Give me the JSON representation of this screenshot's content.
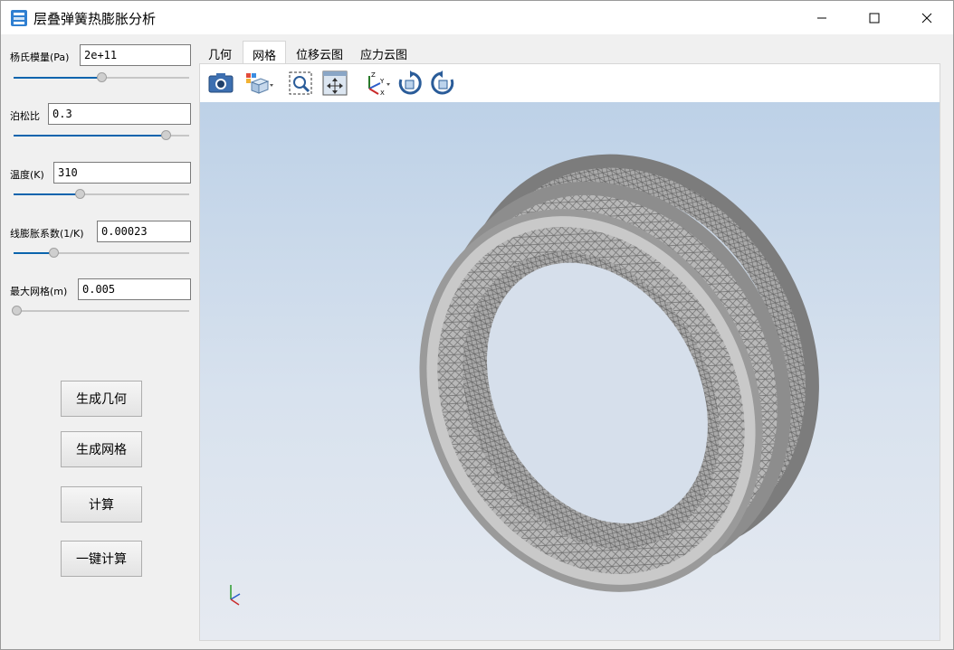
{
  "window": {
    "title": "层叠弹簧热膨胀分析",
    "icon": "app-icon",
    "controls": {
      "minimize": "minimize-icon",
      "maximize": "maximize-icon",
      "close": "close-icon"
    }
  },
  "params": [
    {
      "label": "杨氏模量(Pa)",
      "value": "2e+11",
      "slider_fraction": 0.5
    },
    {
      "label": "泊松比",
      "value": "0.3",
      "slider_fraction": 0.88
    },
    {
      "label": "温度(K)",
      "value": "310",
      "slider_fraction": 0.37
    },
    {
      "label": "线膨胀系数(1/K)",
      "value": "0.00023",
      "slider_fraction": 0.22
    },
    {
      "label": "最大网格(m)",
      "value": "0.005",
      "slider_fraction": 0.0
    }
  ],
  "buttons": {
    "gen_geometry": "生成几何",
    "gen_mesh": "生成网格",
    "compute": "计算",
    "one_click": "一键计算"
  },
  "tabs": [
    {
      "label": "几何",
      "active": false
    },
    {
      "label": "网格",
      "active": true
    },
    {
      "label": "位移云图",
      "active": false
    },
    {
      "label": "应力云图",
      "active": false
    }
  ],
  "toolbar": [
    "camera-icon",
    "view-cube-icon",
    "zoom-box-icon",
    "fit-all-icon",
    "axes-orientation-icon",
    "rotate-cw-icon",
    "rotate-ccw-icon"
  ],
  "colors": {
    "accent": "#0a64ad",
    "viewport_top": "#bdd1e7",
    "viewport_bottom": "#e6eaf1",
    "mesh": "#8a8a8a"
  },
  "viewport": {
    "content": "mesh-model",
    "axis_triad": "axis-triad-icon"
  }
}
